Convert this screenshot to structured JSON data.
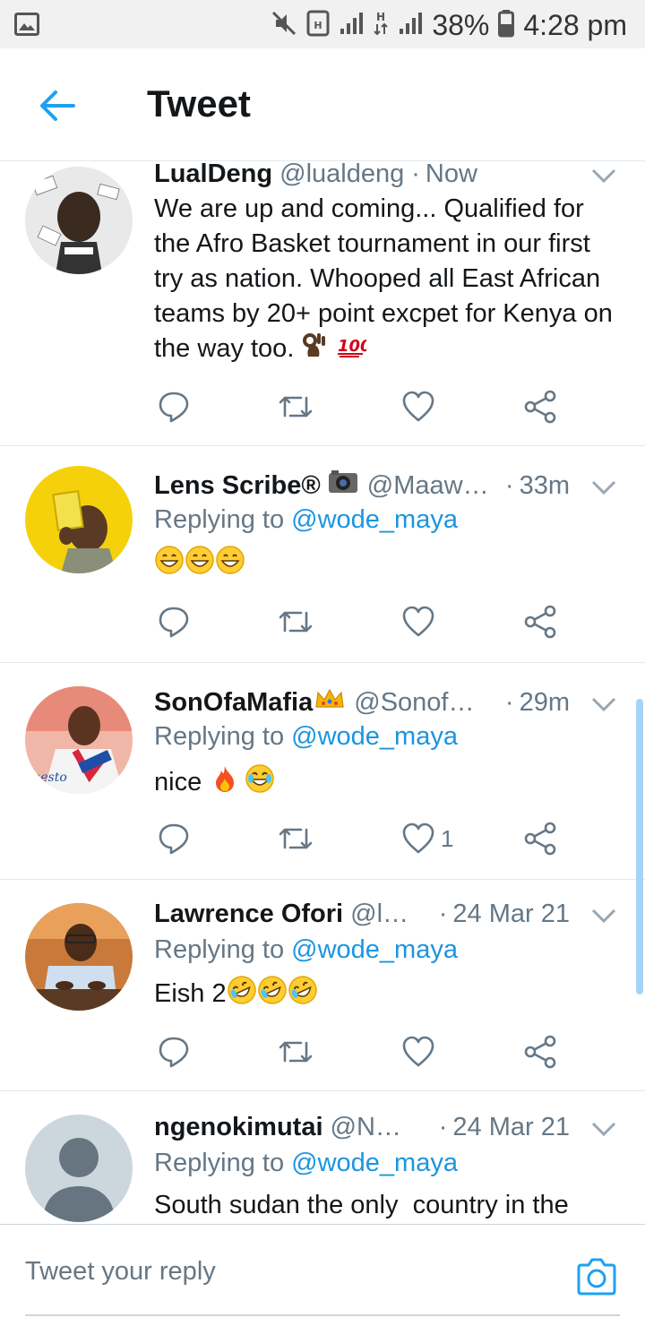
{
  "status_bar": {
    "battery": "38%",
    "time": "4:28 pm",
    "icons": [
      "gallery-icon",
      "mute-icon",
      "data-saver-icon",
      "signal-icon",
      "data-arrows-icon",
      "signal-icon",
      "battery-icon"
    ]
  },
  "header": {
    "title": "Tweet",
    "back_icon": "arrow-left-icon",
    "accent": "#1da1f2"
  },
  "tweets": [
    {
      "name": "LualDeng",
      "handle": "@lualdeng",
      "separator": "·",
      "time": "Now",
      "reply_prefix": "",
      "reply_to": "",
      "text": "We are up and coming... Qualified for the Afro Basket tournament in our first try as nation. Whooped all East African teams by 20+ point excpet for Kenya on the way too.",
      "emojis": [
        "ok-hand-emoji",
        "hundred-points-emoji"
      ],
      "like_count": ""
    },
    {
      "name": "Lens Scribe®",
      "handle": "@Maawe...",
      "separator": "·",
      "time": "33m",
      "reply_prefix": "Replying to",
      "reply_to": "@wode_maya",
      "text": "",
      "emojis": [
        "grinning-emoji",
        "grinning-emoji",
        "grinning-emoji"
      ],
      "name_emoji": "camera-emoji",
      "like_count": ""
    },
    {
      "name": "SonOfaMafia",
      "handle": "@Sonofa...",
      "separator": "·",
      "time": "29m",
      "reply_prefix": "Replying to",
      "reply_to": "@wode_maya",
      "text": "nice",
      "emojis": [
        "fire-emoji",
        "joy-emoji"
      ],
      "name_emoji": "crown-emoji",
      "like_count": "1"
    },
    {
      "name": "Lawrence Ofori",
      "handle": "@la...",
      "separator": "·",
      "time": "24 Mar 21",
      "reply_prefix": "Replying to",
      "reply_to": "@wode_maya",
      "text": "Eish 2",
      "emojis": [
        "rofl-emoji",
        "rofl-emoji",
        "rofl-emoji"
      ],
      "like_count": ""
    },
    {
      "name": "ngenokimutai",
      "handle": "@Nge...",
      "separator": "·",
      "time": "24 Mar 21",
      "reply_prefix": "Replying to",
      "reply_to": "@wode_maya",
      "text": "South sudan the only  country in the",
      "emojis": [],
      "like_count": ""
    }
  ],
  "composer": {
    "placeholder": "Tweet your reply",
    "camera_icon": "camera-icon"
  },
  "colors": {
    "link": "#1b95e0",
    "secondary_text": "#657786",
    "divider": "#e1e8ed"
  }
}
